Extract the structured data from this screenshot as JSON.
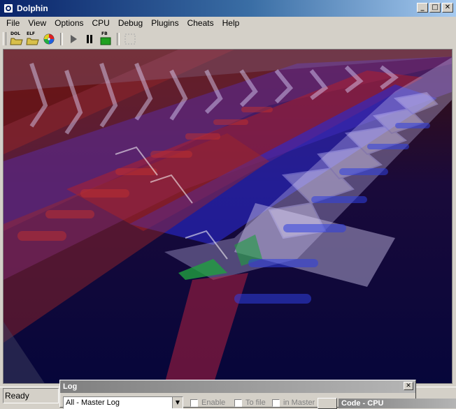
{
  "window": {
    "title": "Dolphin",
    "minimize": "_",
    "maximize": "□",
    "close": "✕"
  },
  "menu": {
    "items": [
      "File",
      "View",
      "Options",
      "CPU",
      "Debug",
      "Plugins",
      "Cheats",
      "Help"
    ]
  },
  "toolbar": {
    "dol_tag": "DOL",
    "elf_tag": "ELF",
    "fb_tag": "FB"
  },
  "status": {
    "text": "Ready"
  },
  "log": {
    "title": "Log",
    "close": "✕",
    "selected": "All - Master Log",
    "enable": "Enable",
    "to_file": "To file",
    "in_master": "in Master"
  },
  "code_window": {
    "title": "Code - CPU"
  }
}
